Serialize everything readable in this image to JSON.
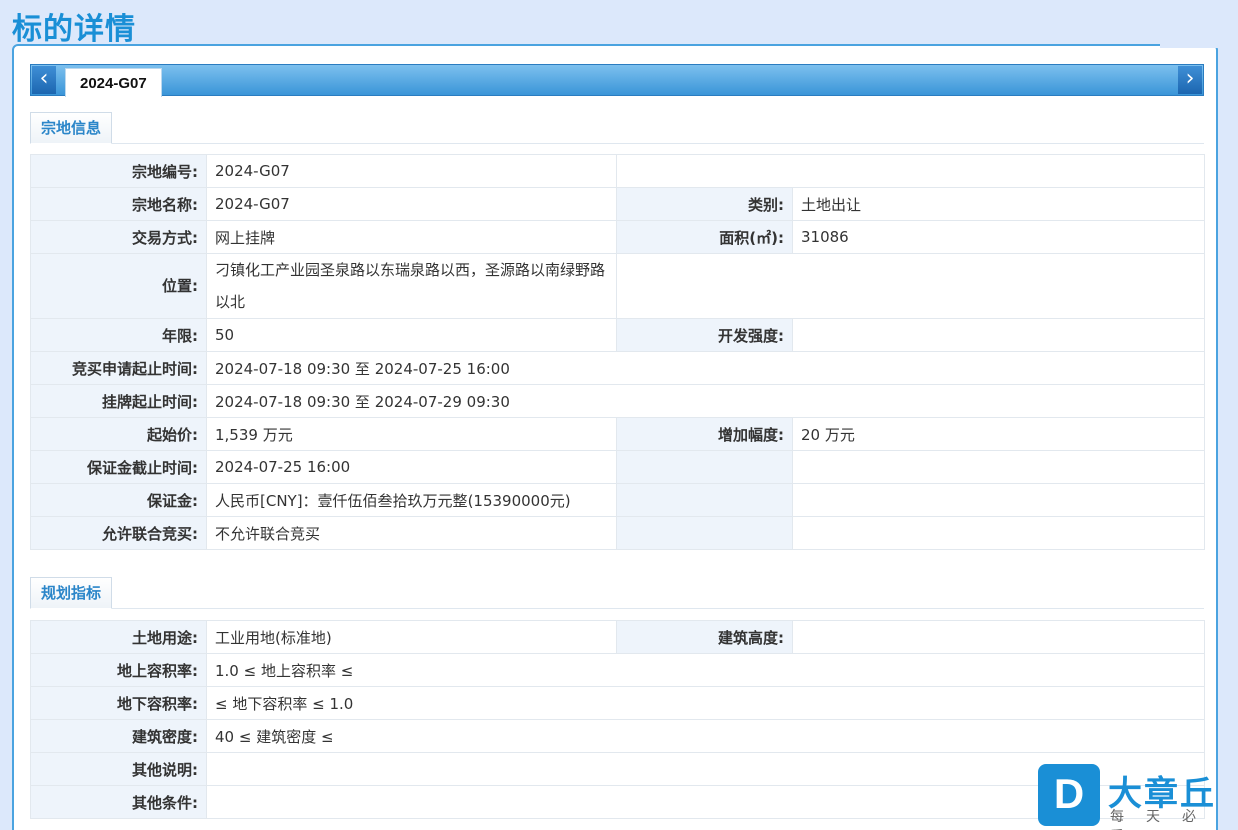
{
  "page": {
    "title": "标的详情"
  },
  "tabbar": {
    "prev_icon": "chevron-left-icon",
    "next_icon": "chevron-right-icon",
    "active_tab": "2024-G07"
  },
  "sections": {
    "parcel": "宗地信息",
    "planning": "规划指标"
  },
  "parcel": {
    "code_label": "宗地编号:",
    "code_value": "2024-G07",
    "name_label": "宗地名称:",
    "name_value": "2024-G07",
    "type_label": "类别:",
    "type_value": "土地出让",
    "trade_label": "交易方式:",
    "trade_value": "网上挂牌",
    "area_label": "面积(㎡):",
    "area_value": "31086",
    "location_label": "位置:",
    "location_value": "刁镇化工产业园圣泉路以东瑞泉路以西，圣源路以南绿野路以北",
    "years_label": "年限:",
    "years_value": "50",
    "intensity_label": "开发强度:",
    "intensity_value": "",
    "apply_label": "竞买申请起止时间:",
    "apply_value": "2024-07-18 09:30 至 2024-07-25 16:00",
    "listing_label": "挂牌起止时间:",
    "listing_value": "2024-07-18 09:30 至 2024-07-29 09:30",
    "start_price_label": "起始价:",
    "start_price_value": "1,539 万元",
    "increment_label": "增加幅度:",
    "increment_value": "20 万元",
    "deposit_deadline_label": "保证金截止时间:",
    "deposit_deadline_value": "2024-07-25 16:00",
    "deposit_label": "保证金:",
    "deposit_value": "人民币[CNY]：壹仟伍佰叁拾玖万元整(15390000元)",
    "joint_label": "允许联合竞买:",
    "joint_value": "不允许联合竞买"
  },
  "planning": {
    "use_label": "土地用途:",
    "use_value": "工业用地(标准地)",
    "height_label": "建筑高度:",
    "height_value": "",
    "far_label": "地上容积率:",
    "far_value": "1.0 ≤ 地上容积率 ≤",
    "ufar_label": "地下容积率:",
    "ufar_value": "≤ 地下容积率 ≤ 1.0",
    "density_label": "建筑密度:",
    "density_value": "40 ≤ 建筑密度 ≤",
    "notes_label": "其他说明:",
    "notes_value": "",
    "conditions_label": "其他条件:",
    "conditions_value": ""
  },
  "logo": {
    "badge": "D",
    "name": "大章丘",
    "tagline": "每天必看"
  },
  "colors": {
    "accent": "#1a8fd6",
    "background": "#dce8fb",
    "label_bg": "#eef4fb"
  }
}
